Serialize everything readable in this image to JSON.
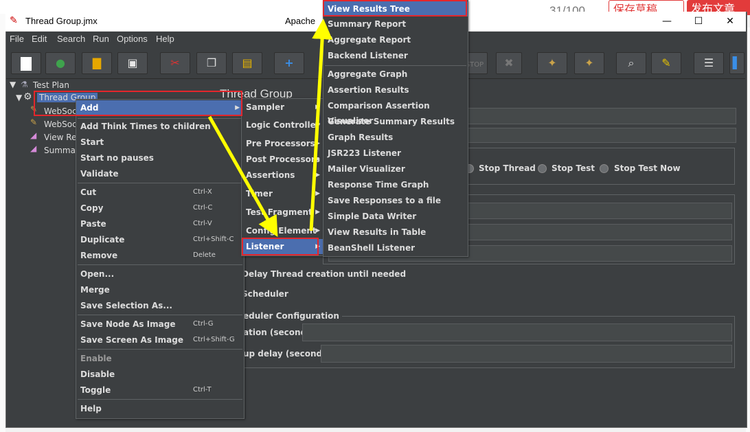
{
  "background": {
    "counter": "31/100",
    "draft_button": "保存草稿",
    "publish_button": "发布文章"
  },
  "window": {
    "title": "Thread Group.jmx",
    "title_right": "Apache",
    "controls": [
      "—",
      "☐",
      "✕"
    ]
  },
  "menubar": [
    "File",
    "Edit",
    "Search",
    "Run",
    "Options",
    "Help"
  ],
  "toolbar_icons": [
    "new-icon",
    "templates-icon",
    "open-icon",
    "save-icon",
    "cut-icon",
    "copy-icon",
    "paste-icon",
    "expand-icon",
    "collapse-icon",
    "toggle-icon",
    "start-icon",
    "start-no-pause-icon",
    "stop-icon",
    "shutdown-icon",
    "clear-icon",
    "clear-all-icon",
    "search-icon",
    "reset-search-icon",
    "function-helper-icon",
    "help-icon"
  ],
  "tree": {
    "root": "Test Plan",
    "thread_group": "Thread Group",
    "children": [
      "WebSoc",
      "WebSoc",
      "View Re",
      "Summar"
    ]
  },
  "panel": {
    "title": "Thread Group",
    "stop_thread": "Stop Thread",
    "stop_test": "Stop Test",
    "stop_test_now": "Stop Test Now",
    "delay_thread": "Delay Thread creation until needed",
    "scheduler": "Scheduler",
    "scheduler_config": "eduler Configuration",
    "duration": "ation (seconds)",
    "startup_delay": "up delay (seconds)"
  },
  "context_menu": {
    "items": [
      {
        "label": "Add",
        "shortcut": "",
        "arrow": true,
        "selected": true
      },
      {
        "label": "Add Think Times to children",
        "shortcut": ""
      },
      {
        "label": "Start",
        "shortcut": ""
      },
      {
        "label": "Start no pauses",
        "shortcut": ""
      },
      {
        "label": "Validate",
        "shortcut": ""
      },
      {
        "label": "Cut",
        "shortcut": "Ctrl-X"
      },
      {
        "label": "Copy",
        "shortcut": "Ctrl-C"
      },
      {
        "label": "Paste",
        "shortcut": "Ctrl-V"
      },
      {
        "label": "Duplicate",
        "shortcut": "Ctrl+Shift-C"
      },
      {
        "label": "Remove",
        "shortcut": "Delete"
      },
      {
        "label": "Open...",
        "shortcut": ""
      },
      {
        "label": "Merge",
        "shortcut": ""
      },
      {
        "label": "Save Selection As...",
        "shortcut": ""
      },
      {
        "label": "Save Node As Image",
        "shortcut": "Ctrl-G"
      },
      {
        "label": "Save Screen As Image",
        "shortcut": "Ctrl+Shift-G"
      },
      {
        "label": "Enable",
        "shortcut": "",
        "disabled": true
      },
      {
        "label": "Disable",
        "shortcut": ""
      },
      {
        "label": "Toggle",
        "shortcut": "Ctrl-T"
      },
      {
        "label": "Help",
        "shortcut": ""
      }
    ]
  },
  "add_submenu": {
    "items": [
      "Sampler",
      "Logic Controller",
      "Pre Processors",
      "Post Processors",
      "Assertions",
      "Timer",
      "Test Fragment",
      "Config Element",
      "Listener"
    ]
  },
  "listener_submenu": {
    "items": [
      "View Results Tree",
      "Summary Report",
      "Aggregate Report",
      "Backend Listener",
      "Aggregate Graph",
      "Assertion Results",
      "Comparison Assertion Visualizer",
      "Generate Summary Results",
      "Graph Results",
      "JSR223 Listener",
      "Mailer Visualizer",
      "Response Time Graph",
      "Save Responses to a file",
      "Simple Data Writer",
      "View Results in Table",
      "BeanShell Listener"
    ]
  },
  "colors": {
    "highlight": "#4b6eaf",
    "red_box": "#e4262b",
    "arrow": "#ffff00"
  }
}
